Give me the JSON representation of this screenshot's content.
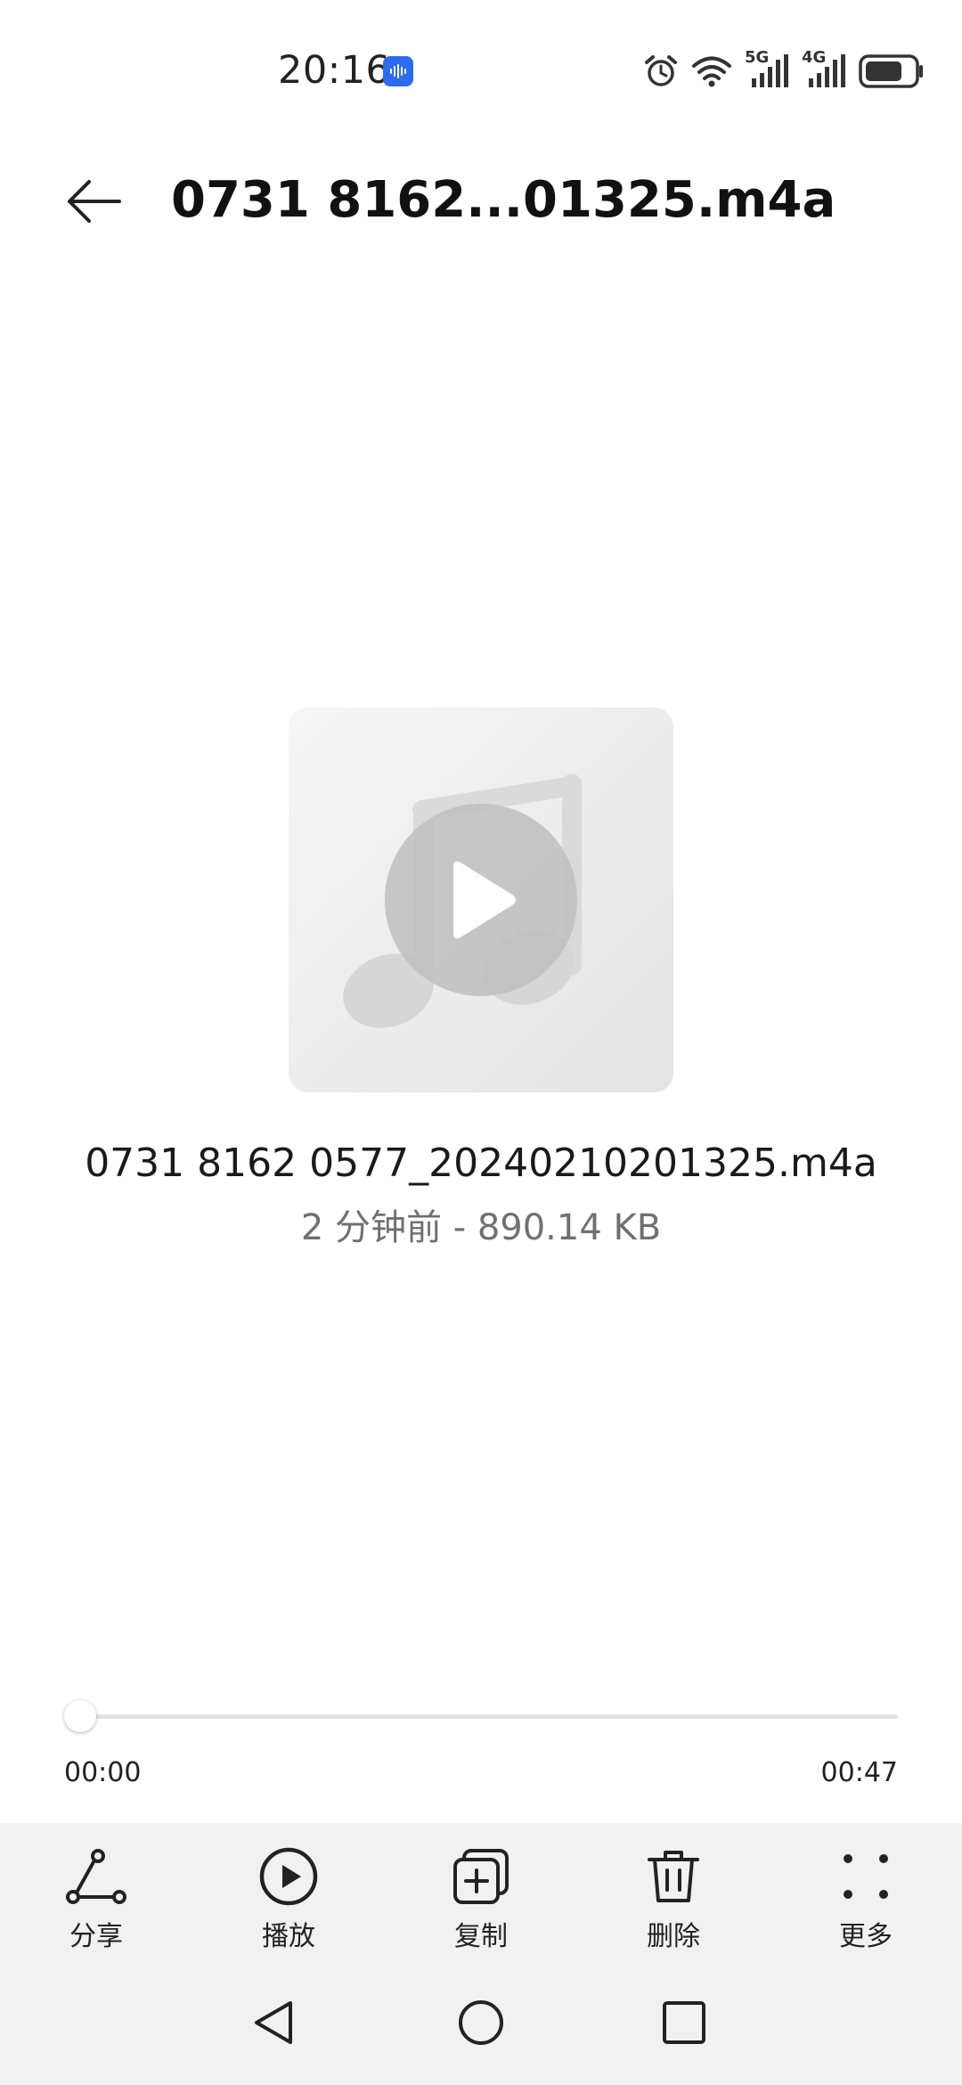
{
  "status_bar": {
    "time": "20:16",
    "net1": "5G",
    "net2": "4G",
    "icons": [
      "voice-recorder-icon",
      "alarm-icon",
      "wifi-icon",
      "signal-5g-icon",
      "signal-4g-icon",
      "battery-icon"
    ]
  },
  "app_bar": {
    "title": "0731 8162...01325.m4a",
    "back_icon": "arrow-left-icon"
  },
  "file": {
    "name": "0731 8162 0577_20240210201325.m4a",
    "meta": "2 分钟前 - 890.14 KB"
  },
  "player": {
    "current_time": "00:00",
    "total_time": "00:47",
    "progress": 0
  },
  "toolbar": {
    "share": "分享",
    "play": "播放",
    "copy": "复制",
    "delete": "删除",
    "more": "更多"
  },
  "colors": {
    "accent": "#0a59f7",
    "panel_bg": "#f1f1f1",
    "status_app": "#2d6bf0"
  }
}
